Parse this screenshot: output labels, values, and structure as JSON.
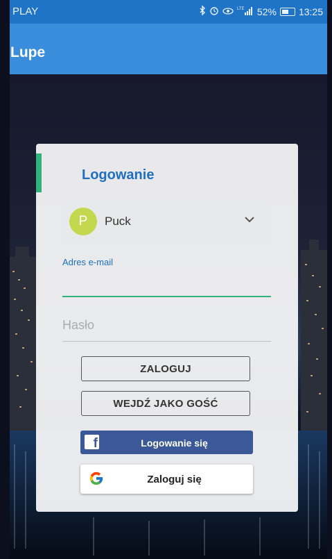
{
  "status_bar": {
    "carrier": "PLAY",
    "icons": [
      "bluetooth-icon",
      "alarm-icon",
      "eye-icon",
      "lte-signal-icon",
      "battery-icon"
    ],
    "network": "LTE",
    "battery": "52%",
    "time": "13:25"
  },
  "app_bar": {
    "title": "Lupe"
  },
  "login": {
    "heading": "Logowanie",
    "account": {
      "initial": "P",
      "name": "Puck"
    },
    "email_label": "Adres e-mail",
    "password_placeholder": "Hasło",
    "login_button": "ZALOGUJ",
    "guest_button": "WEJDŹ JAKO GOŚĆ",
    "facebook_button": "Logowanie się",
    "facebook_icon": "f",
    "google_button": "Zaloguj się"
  },
  "colors": {
    "status_bar": "#1f74c7",
    "app_bar": "#3a8ddb",
    "accent": "#2fb37a",
    "heading": "#1f6fbf",
    "facebook": "#3b5998",
    "avatar": "#c3d84e"
  }
}
